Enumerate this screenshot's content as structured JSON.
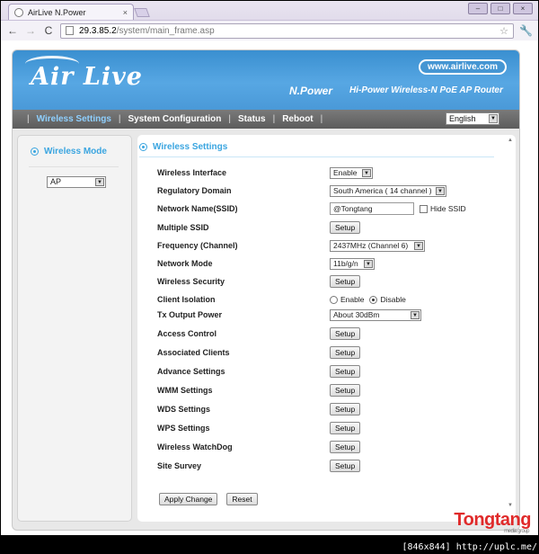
{
  "browser": {
    "tab_title": "AirLive N.Power",
    "tab_close": "×",
    "url_host": "29.3.85.2",
    "url_path": "/system/main_frame.asp",
    "back": "←",
    "forward": "→",
    "reload": "C",
    "star": "☆",
    "wrench": "🔧"
  },
  "header": {
    "logo": "Air Live",
    "site_url": "www.airlive.com",
    "model": "N.Power",
    "tagline": "Hi-Power Wireless-N PoE AP Router"
  },
  "menu": {
    "items": [
      "Wireless Settings",
      "System Configuration",
      "Status",
      "Reboot"
    ],
    "language": "English"
  },
  "sidebar": {
    "title": "Wireless Mode",
    "mode_value": "AP"
  },
  "main": {
    "title": "Wireless Settings",
    "rows": [
      {
        "label": "Wireless Interface",
        "value": "Enable"
      },
      {
        "label": "Regulatory Domain",
        "value": "South America ( 14 channel )"
      },
      {
        "label": "Network Name(SSID)",
        "value": "@Tongtang",
        "extra": "Hide SSID"
      },
      {
        "label": "Multiple SSID",
        "button": "Setup"
      },
      {
        "label": "Frequency (Channel)",
        "value": "2437MHz (Channel 6)"
      },
      {
        "label": "Network Mode",
        "value": "11b/g/n"
      },
      {
        "label": "Wireless Security",
        "button": "Setup"
      },
      {
        "label": "Client Isolation",
        "opt1": "Enable",
        "opt2": "Disable"
      },
      {
        "label": "Tx Output Power",
        "value": "About 30dBm"
      },
      {
        "label": "Access Control",
        "button": "Setup"
      },
      {
        "label": "Associated Clients",
        "button": "Setup"
      },
      {
        "label": "Advance Settings",
        "button": "Setup"
      },
      {
        "label": "WMM Settings",
        "button": "Setup"
      },
      {
        "label": "WDS Settings",
        "button": "Setup"
      },
      {
        "label": "WPS Settings",
        "button": "Setup"
      },
      {
        "label": "Wireless WatchDog",
        "button": "Setup"
      },
      {
        "label": "Site Survey",
        "button": "Setup"
      }
    ],
    "apply": "Apply Change",
    "reset": "Reset"
  },
  "brand": {
    "name": "Tongtang",
    "sub": "media group"
  },
  "watermark": "[846x844] http://uplc.me/"
}
